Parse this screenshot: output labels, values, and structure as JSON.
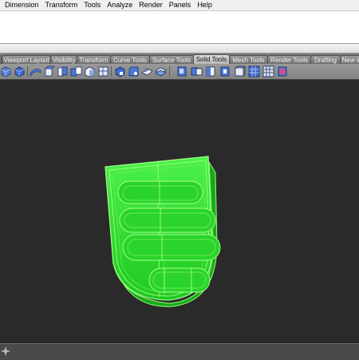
{
  "menubar": {
    "items": [
      "Dimension",
      "Transform",
      "Tools",
      "Analyze",
      "Render",
      "Panels",
      "Help"
    ]
  },
  "tabs": {
    "items": [
      "Viewport Layout",
      "Visibility",
      "Transform",
      "Curve Tools",
      "Surface Tools",
      "Solid Tools",
      "Mesh Tools",
      "Render Tools",
      "Drafting",
      "New in"
    ],
    "active": "Solid Tools"
  },
  "toolbar": {
    "icons": [
      "solid-cube-icon",
      "solid-cube-blue-icon",
      "pipe-icon",
      "extrude-face-icon",
      "boolean-union-icon",
      "boolean-difference-icon",
      "solid-box-icon",
      "cap-planar-icon",
      "extract-surface-icon",
      "fillet-edge-icon",
      "chamfer-edge-icon",
      "offset-surface-icon",
      "solid-edit-icon",
      "move-face-icon",
      "split-face-icon",
      "shell-icon",
      "wireframe-box-icon",
      "grid-cube-icon",
      "cube-pink-icon"
    ]
  },
  "colors": {
    "model_green": "#3ef23e",
    "model_edge": "#7dff6a",
    "viewport_bg": "#2a2a2a"
  }
}
